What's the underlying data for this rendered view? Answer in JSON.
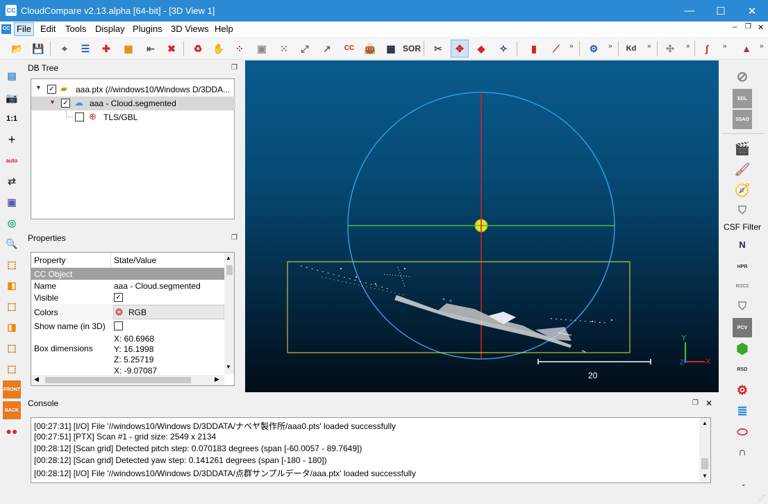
{
  "window": {
    "title": "CloudCompare v2.13.alpha [64-bit] - [3D View 1]",
    "minimize": "—",
    "maximize": "☐",
    "close": "✕"
  },
  "menu": {
    "file": "File",
    "edit": "Edit",
    "tools": "Tools",
    "display": "Display",
    "plugins": "Plugins",
    "views": "3D Views",
    "help": "Help"
  },
  "panels": {
    "db_tree": "DB Tree",
    "properties": "Properties",
    "console": "Console"
  },
  "tree": {
    "root": "aaa.ptx (//windows10/Windows D/3DDA...",
    "cloud": "aaa - Cloud.segmented",
    "sensor": "TLS/GBL"
  },
  "props": {
    "col_property": "Property",
    "col_value": "State/Value",
    "section": "CC Object",
    "name_label": "Name",
    "name_value": "aaa - Cloud.segmented",
    "visible_label": "Visible",
    "colors_label": "Colors",
    "colors_value": "RGB",
    "showname_label": "Show name (in 3D)",
    "box_label": "Box dimensions",
    "box_x": "X: 60.6968",
    "box_y": "Y: 16.1998",
    "box_z": "Z: 5.25719",
    "box_extra": "X: -9.07087"
  },
  "view": {
    "scale_label": "20",
    "axis_x": "X",
    "axis_y": "Y",
    "axis_z": "Z"
  },
  "right_toolbar": {
    "csf_label": "CSF Filter",
    "edl": "EDL",
    "ssao": "SSAO",
    "hpr": "HPR",
    "m3c2": "M3C2",
    "pcv": "PCV",
    "rsd": "RSD",
    "north": "N"
  },
  "left_toolbar": {
    "one_to_one": "1:1",
    "auto": "auto",
    "front": "FRONT",
    "back": "BACK"
  },
  "toolbar": {
    "sor": "SOR",
    "kd": "Kd",
    "cc": "CC"
  },
  "console_lines": [
    "[00:27:31] [I/O] File '//windows10/Windows D/3DDATA/ナベヤ製作所/aaa0.pts' loaded successfully",
    "[00:27:51] [PTX] Scan #1 - grid size: 2549 x 2134",
    "[00:28:12] [Scan grid] Detected pitch step: 0.070183 degrees (span [-60.0057 - 89.7649])",
    "[00:28:12] [Scan grid] Detected yaw step: 0.141261 degrees (span [-180 - 180])",
    "[00:28:12] [I/O] File '//windows10/Windows D/3DDATA/点群サンプルデータ/aaa.ptx' loaded successfully"
  ],
  "colors": {
    "titlebar": "#2b8ad3",
    "circle": "#2a9fe0",
    "horizontal_axis": "#34c830",
    "vertical_axis": "#e0201a",
    "bbox": "#e8e830"
  }
}
